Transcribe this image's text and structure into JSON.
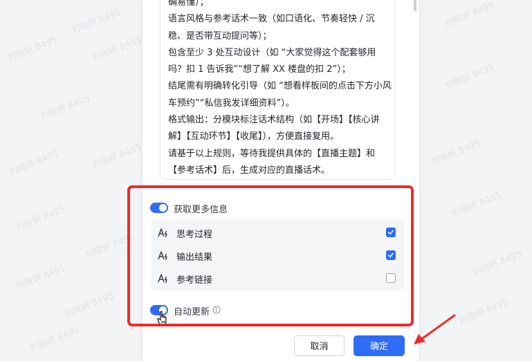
{
  "prompt_text": {
    "lines": [
      "确易懂）；",
      "语言风格与参考话术一致（如口语化、节奏轻快 / 沉",
      "稳、是否带互动提问等）；",
      "包含至少 3 处互动设计（如 “大家觉得这个配套够用",
      "吗？扣 1 告诉我”“想了解 XX 楼盘的扣 2”）；",
      "结尾需有明确转化引导（如 “想看样板间的点击下方小风",
      "车预约”“私信我发详细资料”）。",
      "格式输出：分模块标注话术结构（如【开场】【核心讲",
      "解】【互动环节】【收尾】），方便直接复用。",
      "请基于以上规则，等待我提供具体的【直播主题】和",
      "【参考话术】后，生成对应的直播话术。"
    ]
  },
  "more_info": {
    "label": "获取更多信息",
    "enabled": true,
    "options": [
      {
        "label": "思考过程",
        "checked": true,
        "icon": "ai-text-icon"
      },
      {
        "label": "输出结果",
        "checked": true,
        "icon": "ai-text-icon"
      },
      {
        "label": "参考链接",
        "checked": false,
        "icon": "ai-text-icon"
      }
    ]
  },
  "auto_update": {
    "label": "自动更新",
    "enabled": true,
    "info_icon": "info-icon"
  },
  "footer": {
    "cancel_label": "取消",
    "confirm_label": "确定"
  },
  "watermark": {
    "text": "刘晓妍 8495"
  },
  "colors": {
    "accent": "#2f6cf6",
    "highlight": "#ee2b2b"
  }
}
